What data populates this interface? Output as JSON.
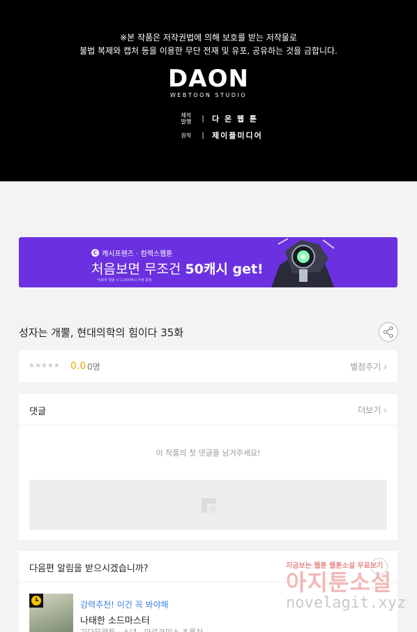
{
  "notice": {
    "line1": "※본 작품은 저작권법에 의해 보호를 받는 저작물로",
    "line2": "불법 복제와 캡처 등을 이용한 무단 전재 및 유포, 공유하는 것을 금합니다.",
    "logo": "DAON",
    "logo_sub": "WEBTOON STUDIO",
    "credits": [
      {
        "key": "제작\n발행",
        "sep": "|",
        "value": "다 온 웹 툰"
      },
      {
        "key": "원작",
        "sep": "|",
        "value": "제이플미디어"
      }
    ]
  },
  "banner": {
    "tag_icon": "C",
    "tag": "캐시프렌즈 · 컴렉스웹툰",
    "main_prefix": "처음보면 무조건 ",
    "main_bold": "50캐시 get!!",
    "fine": "*5화차 열람 시 1,000캐시 추첨 증정"
  },
  "episode": {
    "title": "성자는 개뿔, 현대의학의 힘이다 35화"
  },
  "rating": {
    "stars": "★★★★★",
    "score": "0.0",
    "count": "0명",
    "rate_label": "별점주기 ›"
  },
  "comments": {
    "title": "댓글",
    "more": "더보기 ›",
    "empty": "이 작품의 첫 댓글을 남겨주세요!"
  },
  "next": {
    "question": "다음편 알림을 받으시겠습니까?",
    "recommend": "강력추천! 이건 꼭 봐야해",
    "title": "나태한 소드마스터",
    "meta": "기다무웹툰 · 소년 · 마르코미스 초록차"
  },
  "watermark": {
    "top": "지금보는 웹툰 웹툰소설 무료보기",
    "big": "아지툰소설",
    "url": "novelagit.xyz"
  },
  "colors": {
    "banner": "#6b30e0",
    "score": "#f0a400",
    "recommend": "#3b7fe0"
  }
}
